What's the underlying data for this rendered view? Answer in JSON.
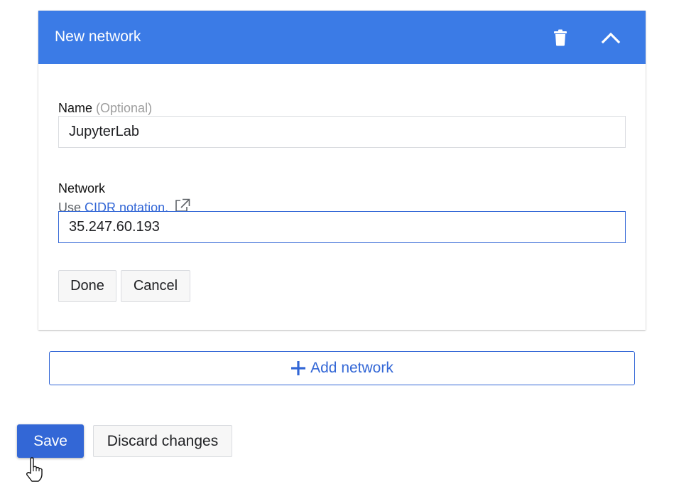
{
  "card": {
    "title": "New network",
    "delete_icon": "trash-icon",
    "collapse_icon": "chevron-up-icon"
  },
  "name_field": {
    "label": "Name",
    "optional": "(Optional)",
    "value": "JupyterLab"
  },
  "network_field": {
    "label": "Network",
    "hint_prefix": "Use",
    "hint_link": "CIDR notation.",
    "hint_link_icon": "external-link-icon",
    "value": "35.247.60.193"
  },
  "form_actions": {
    "done": "Done",
    "cancel": "Cancel"
  },
  "add_network": {
    "icon": "plus-icon",
    "label": "Add network"
  },
  "page_actions": {
    "save": "Save",
    "discard": "Discard changes"
  },
  "colors": {
    "header_bg": "#3b7be6",
    "accent": "#3367d6",
    "link": "#3367d6"
  }
}
